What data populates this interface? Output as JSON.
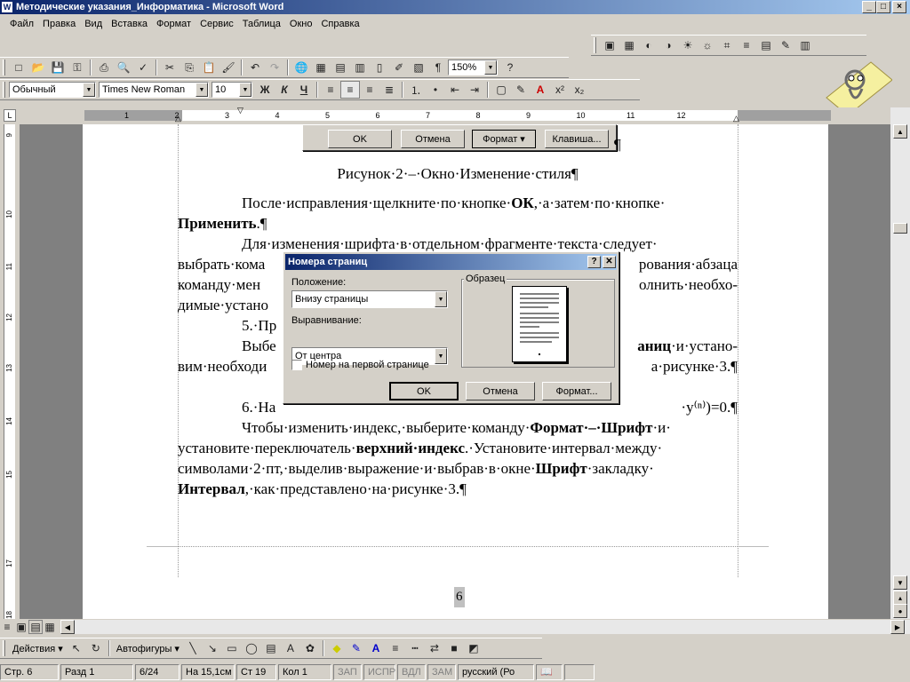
{
  "window": {
    "title": "Методические указания_Информатика - Microsoft Word"
  },
  "menu": [
    "Файл",
    "Правка",
    "Вид",
    "Вставка",
    "Формат",
    "Сервис",
    "Таблица",
    "Окно",
    "Справка"
  ],
  "format_bar": {
    "style": "Обычный",
    "font": "Times New Roman",
    "size": "10",
    "bold": "Ж",
    "italic": "К",
    "underline": "Ч",
    "superscript": "x²",
    "subscript": "x₂"
  },
  "standard_bar": {
    "zoom": "150%",
    "pilcrow": "¶",
    "help": "?"
  },
  "ruler": {
    "h_ticks": [
      "1",
      "2",
      "3",
      "4",
      "5",
      "6",
      "7",
      "8",
      "9",
      "10",
      "11",
      "12"
    ],
    "v_ticks": [
      "9",
      "10",
      "11",
      "12",
      "13",
      "14",
      "15",
      "17",
      "18"
    ]
  },
  "top_dialog_buttons": {
    "ok": "OK",
    "cancel": "Отмена",
    "format": "Формат ▾",
    "keys": "Клавиша..."
  },
  "document": {
    "caption": "Рисунок·2·–·Окно·Изменение·стиля¶",
    "pilcrow": "¶",
    "lines": [
      {
        "indent": true,
        "segments": [
          {
            "t": "После·исправления·щелкните·по·кнопке·",
            "b": false
          },
          {
            "t": "ОК",
            "b": true
          },
          {
            "t": ",·а·затем·по·кнопке·",
            "b": false
          }
        ]
      },
      {
        "indent": false,
        "segments": [
          {
            "t": "Применить",
            "b": true
          },
          {
            "t": ".¶",
            "b": false
          }
        ]
      },
      {
        "indent": true,
        "segments": [
          {
            "t": "Для·изменения·шрифта·в·отдельном·фрагменте·текста·следует·",
            "b": false
          }
        ]
      },
      {
        "indent": false,
        "segments": [
          {
            "t": "выбрать·кома",
            "b": false
          }
        ],
        "right": "рования·абзаца"
      },
      {
        "indent": false,
        "segments": [
          {
            "t": "команду·мен",
            "b": false
          }
        ],
        "right": "олнить·необхо-"
      },
      {
        "indent": false,
        "segments": [
          {
            "t": "димые·устано",
            "b": false
          }
        ]
      },
      {
        "indent": true,
        "segments": [
          {
            "t": "5.·Пр",
            "b": false
          }
        ]
      },
      {
        "indent": true,
        "segments": [
          {
            "t": "Выбе",
            "b": false
          }
        ],
        "right_bold": "аниц",
        "right": "·и·устано-"
      },
      {
        "indent": false,
        "segments": [
          {
            "t": "вим·необходи",
            "b": false
          }
        ],
        "right": "а·рисунке·3.¶"
      },
      {
        "indent": false,
        "segments": [
          {
            "t": " ",
            "b": false
          }
        ]
      },
      {
        "indent": true,
        "segments": [
          {
            "t": "6.·На",
            "b": false
          }
        ],
        "right": "·y⁽ⁿ⁾)=0.¶"
      },
      {
        "indent": true,
        "segments": [
          {
            "t": "Чтобы·изменить·индекс,·выберите·команду·",
            "b": false
          },
          {
            "t": "Формат·–·Шрифт",
            "b": true
          },
          {
            "t": "·и·",
            "b": false
          }
        ]
      },
      {
        "indent": false,
        "segments": [
          {
            "t": "установите·переключатель·",
            "b": false
          },
          {
            "t": "верхний·индекс",
            "b": true
          },
          {
            "t": ".·Установите·интервал·между·",
            "b": false
          }
        ]
      },
      {
        "indent": false,
        "segments": [
          {
            "t": "символами·2·пт,·выделив·выражение·и·выбрав·в·окне·",
            "b": false
          },
          {
            "t": "Шрифт",
            "b": true
          },
          {
            "t": "·закладку·",
            "b": false
          }
        ]
      },
      {
        "indent": false,
        "segments": [
          {
            "t": "Интервал",
            "b": true
          },
          {
            "t": ",·как·представлено·на·рисунке·3.¶",
            "b": false
          }
        ]
      }
    ],
    "page_number": "6"
  },
  "dialog": {
    "title": "Номера страниц",
    "position_label": "Положение:",
    "position_value": "Внизу страницы",
    "align_label": "Выравнивание:",
    "align_value": "От центра",
    "first_page_label": "Номер на первой странице",
    "sample_label": "Образец",
    "ok": "OK",
    "cancel": "Отмена",
    "format": "Формат...",
    "help_btn": "?",
    "close_btn": "✕"
  },
  "drawing_bar": {
    "actions": "Действия ▾",
    "autoshapes": "Автофигуры ▾"
  },
  "status": {
    "page": "Стр. 6",
    "section": "Разд 1",
    "pages": "6/24",
    "at": "На 15,1см",
    "line": "Ст 19",
    "col": "Кол 1",
    "rec": "ЗАП",
    "trk": "ИСПР",
    "ext": "ВДЛ",
    "ovr": "ЗАМ",
    "lang": "русский (Ро"
  }
}
